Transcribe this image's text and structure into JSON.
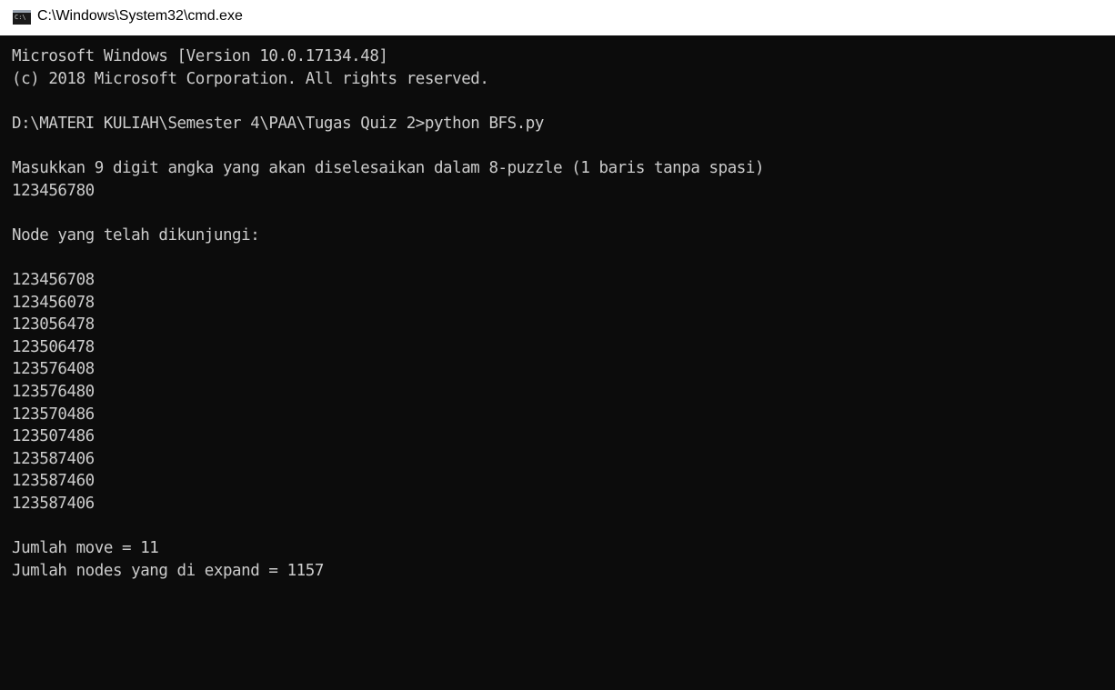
{
  "window": {
    "title": "C:\\Windows\\System32\\cmd.exe",
    "icon": "cmd-console-icon",
    "icon_glyph": "C:\\"
  },
  "console": {
    "background": "#0c0c0c",
    "foreground": "#cccccc",
    "lines": [
      "Microsoft Windows [Version 10.0.17134.48]",
      "(c) 2018 Microsoft Corporation. All rights reserved.",
      "",
      "D:\\MATERI KULIAH\\Semester 4\\PAA\\Tugas Quiz 2>python BFS.py",
      "",
      "Masukkan 9 digit angka yang akan diselesaikan dalam 8-puzzle (1 baris tanpa spasi)",
      "123456780",
      "",
      "Node yang telah dikunjungi:",
      "",
      "123456708",
      "123456078",
      "123056478",
      "123506478",
      "123576408",
      "123576480",
      "123570486",
      "123507486",
      "123587406",
      "123587460",
      "123587406",
      "",
      "Jumlah move = 11",
      "Jumlah nodes yang di expand = 1157"
    ]
  }
}
